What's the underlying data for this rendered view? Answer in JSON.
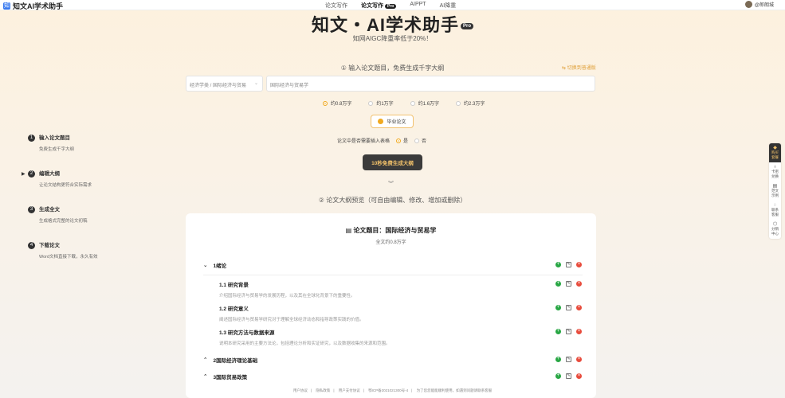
{
  "nav": {
    "logo_text": "知文AI学术助手",
    "items": [
      "论文写作",
      "论文写作",
      "AIPPT",
      "AI降重"
    ],
    "active_badge": "Pro",
    "user_name": "@郎朗城"
  },
  "hero": {
    "title": "知文・AI学术助手",
    "badge": "Pro",
    "subtitle": "知网AIGC降重率低于20%！"
  },
  "step1": {
    "title": "① 输入论文题目，免费生成千字大纲",
    "switch_link": "切换到普通版"
  },
  "inputs": {
    "major": "经济学类 / 国际经济与贸易",
    "topic": "国际经济与贸易学"
  },
  "word_counts": {
    "options": [
      "约0.8万字",
      "约1万字",
      "约1.6万字",
      "约2.3万字"
    ],
    "selected": 0
  },
  "paper_type": "毕业论文",
  "table_question": {
    "label": "论文中是否需要插入表格",
    "yes": "是",
    "no": "否"
  },
  "generate_button": "10秒免费生成大纲",
  "step2": {
    "title": "② 论文大纲预览（可自由编辑、修改、增加或删除）"
  },
  "steps": [
    {
      "num": "1",
      "title": "输入论文题目",
      "desc": "免费生成千字大纲"
    },
    {
      "num": "2",
      "title": "编辑大纲",
      "desc": "让论文结构更符合实际需求"
    },
    {
      "num": "3",
      "title": "生成全文",
      "desc": "生成格式完整的论文初稿"
    },
    {
      "num": "4",
      "title": "下载论文",
      "desc": "Word文档直接下载，永久有效"
    }
  ],
  "outline": {
    "title": "论文题目：国际经济与贸易学",
    "subtitle": "全文约0.8万字",
    "chapters": [
      {
        "title": "1绪论",
        "sections": [
          {
            "title": "1.1 研究背景",
            "desc": "介绍国际经济与贸易学的发展历程，以及其在全球化背景下的重要性。"
          },
          {
            "title": "1.2 研究意义",
            "desc": "阐述国际经济与贸易学研究对于理解全球经济动态和指导政策实践的价值。"
          },
          {
            "title": "1.3 研究方法与数据来源",
            "desc": "说明本研究采用的主要方法论，包括理论分析和实证研究，以及数据收集的来源和范围。"
          }
        ]
      },
      {
        "title": "2国际经济理论基础",
        "sections": []
      },
      {
        "title": "3国际贸易政策",
        "sections": []
      }
    ]
  },
  "rail": {
    "top": "购买套餐",
    "items": [
      "卡密兑换",
      "范文示例",
      "联系客服",
      "分销中心"
    ]
  },
  "footer": {
    "links": [
      "用户协议",
      "隐私政策",
      "用户支付协议",
      "鄂ICP备2021021300号-4",
      "为了您您能能顺利使用，如遇到问题请联系客服"
    ]
  }
}
